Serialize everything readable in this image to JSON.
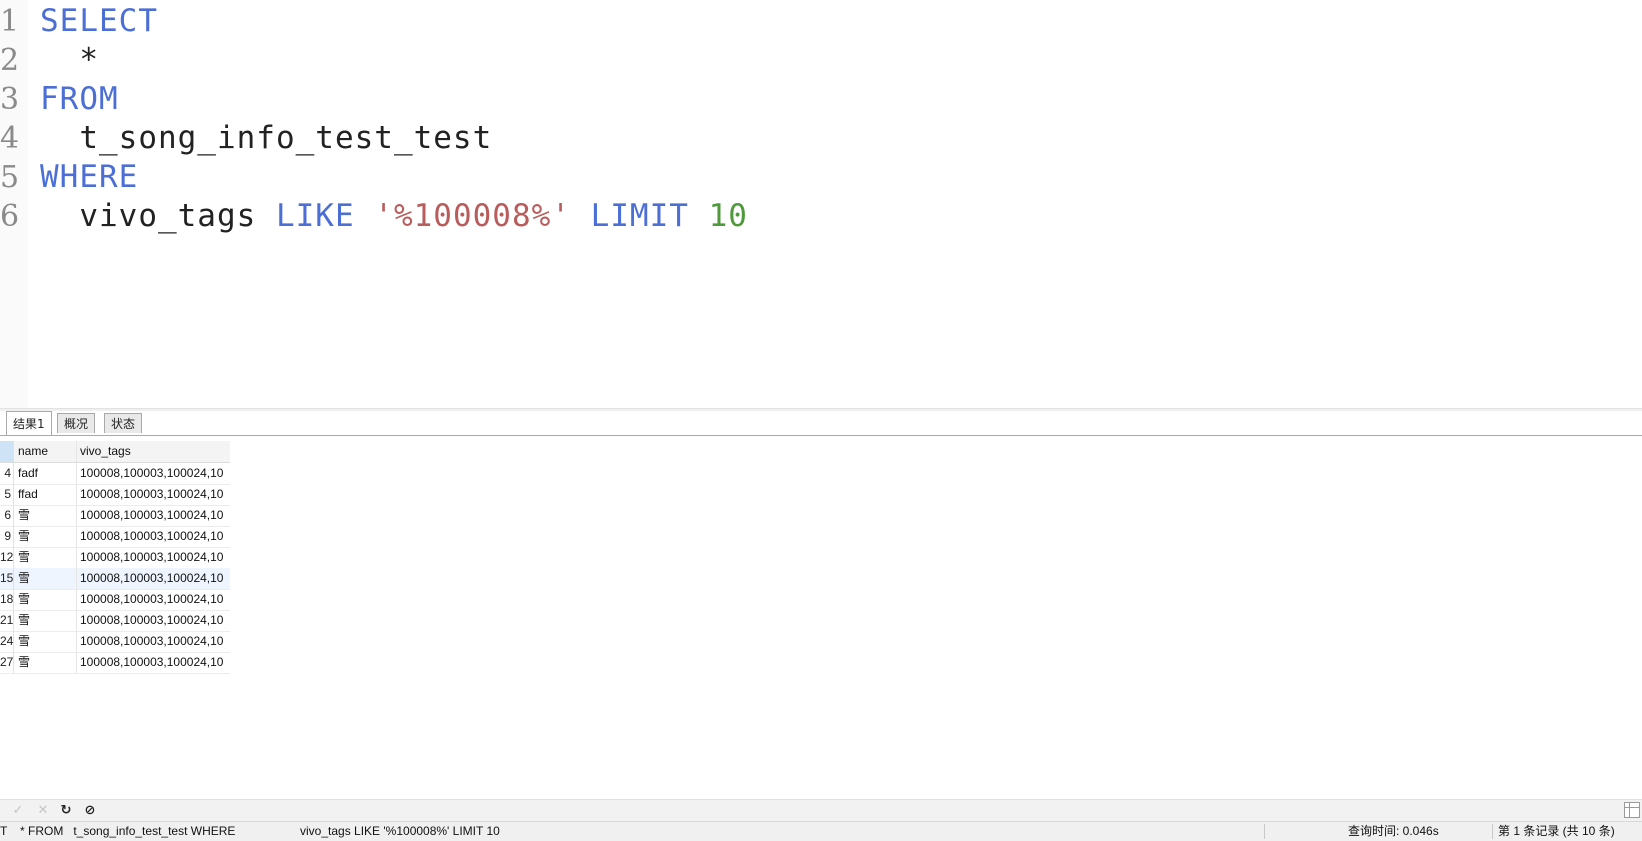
{
  "editor": {
    "lines": [
      {
        "number": "1",
        "tokens": [
          {
            "text": "SELECT",
            "kind": "keyword"
          }
        ]
      },
      {
        "number": "2",
        "tokens": [
          {
            "text": "  *",
            "kind": "plain"
          }
        ]
      },
      {
        "number": "3",
        "tokens": [
          {
            "text": "FROM",
            "kind": "keyword"
          }
        ]
      },
      {
        "number": "4",
        "tokens": [
          {
            "text": "  t_song_info_test_test",
            "kind": "plain"
          }
        ]
      },
      {
        "number": "5",
        "tokens": [
          {
            "text": "WHERE",
            "kind": "keyword"
          }
        ]
      },
      {
        "number": "6",
        "tokens": [
          {
            "text": "  vivo_tags ",
            "kind": "plain"
          },
          {
            "text": "LIKE ",
            "kind": "keyword"
          },
          {
            "text": "'%100008%' ",
            "kind": "string"
          },
          {
            "text": "LIMIT ",
            "kind": "keyword"
          },
          {
            "text": "10",
            "kind": "number"
          }
        ]
      }
    ]
  },
  "tabs": [
    {
      "label": "结果1",
      "active": true
    },
    {
      "label": "概况",
      "active": false
    },
    {
      "label": "状态",
      "active": false
    }
  ],
  "grid": {
    "columns": [
      "name",
      "vivo_tags"
    ],
    "rows": [
      {
        "idx": "4",
        "name": "fadf",
        "vivo_tags": "100008,100003,100024,10"
      },
      {
        "idx": "5",
        "name": "ffad",
        "vivo_tags": "100008,100003,100024,10"
      },
      {
        "idx": "6",
        "name": "雪",
        "vivo_tags": "100008,100003,100024,10"
      },
      {
        "idx": "9",
        "name": "雪",
        "vivo_tags": "100008,100003,100024,10"
      },
      {
        "idx": "12",
        "name": "雪",
        "vivo_tags": "100008,100003,100024,10"
      },
      {
        "idx": "15",
        "name": "雪",
        "vivo_tags": "100008,100003,100024,10"
      },
      {
        "idx": "18",
        "name": "雪",
        "vivo_tags": "100008,100003,100024,10"
      },
      {
        "idx": "21",
        "name": "雪",
        "vivo_tags": "100008,100003,100024,10"
      },
      {
        "idx": "24",
        "name": "雪",
        "vivo_tags": "100008,100003,100024,10"
      },
      {
        "idx": "27",
        "name": "雪",
        "vivo_tags": "100008,100003,100024,10"
      }
    ]
  },
  "toolbar": {
    "apply_icon": "✓",
    "discard_icon": "✕",
    "refresh_icon": "↻",
    "stop_icon": "⊘"
  },
  "statusbar": {
    "query_prefix": "T",
    "query_part1": "* FROM   t_song_info_test_test WHERE",
    "query_part2": "vivo_tags LIKE '%100008%' LIMIT 10",
    "query_time": "查询时间: 0.046s",
    "record_info": "第 1 条记录 (共 10 条)"
  },
  "colors": {
    "keyword": "#4c6fd6",
    "string": "#b95c5c",
    "number": "#4f9a3a"
  }
}
